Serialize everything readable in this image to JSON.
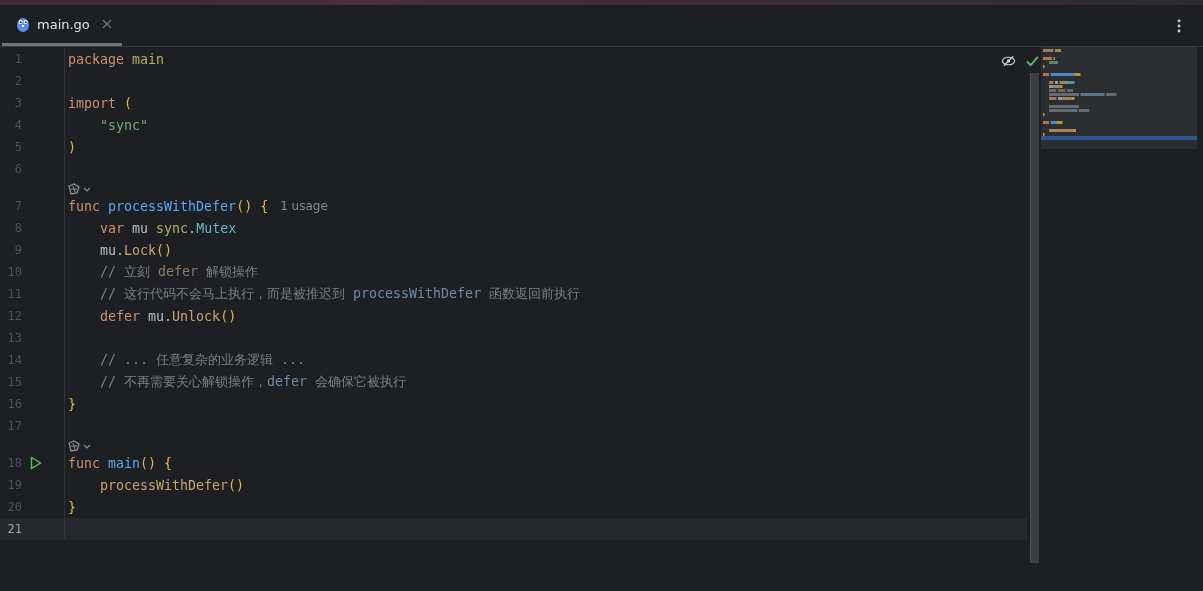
{
  "tabs": [
    {
      "label": "main.go",
      "selected": true
    }
  ],
  "lines": [
    {
      "number": "1",
      "current": false,
      "tokens": [
        {
          "t": "package ",
          "kind": "kw"
        },
        {
          "t": "main",
          "kind": "pkg"
        }
      ]
    },
    {
      "number": "2",
      "current": false
    },
    {
      "number": "3",
      "current": false,
      "tokens": [
        {
          "t": "import ",
          "kind": "kw"
        },
        {
          "t": "(",
          "kind": "paren"
        }
      ]
    },
    {
      "number": "4",
      "current": false,
      "tokens": [
        {
          "t": "    \"sync\"",
          "kind": "str"
        }
      ]
    },
    {
      "number": "5",
      "current": false,
      "tokens": [
        {
          "t": ")",
          "kind": "paren"
        }
      ]
    },
    {
      "number": "6",
      "current": false
    },
    {
      "number": "7",
      "current": false,
      "lens": true,
      "hint": "1 usage",
      "tokens": [
        {
          "t": "func ",
          "kind": "kw"
        },
        {
          "t": "processWithDefer",
          "kind": "fn"
        },
        {
          "t": "() {",
          "kind": "paren"
        }
      ]
    },
    {
      "number": "8",
      "current": false,
      "tokens": [
        {
          "t": "    var ",
          "kind": "kw"
        },
        {
          "t": "mu ",
          "kind": "plain"
        },
        {
          "t": "sync",
          "kind": "pkg"
        },
        {
          "t": ".",
          "kind": "plain"
        },
        {
          "t": "Mutex",
          "kind": "type"
        }
      ]
    },
    {
      "number": "9",
      "current": false,
      "tokens": [
        {
          "t": "    mu.",
          "kind": "plain"
        },
        {
          "t": "Lock",
          "kind": "method"
        },
        {
          "t": "()",
          "kind": "paren"
        }
      ]
    },
    {
      "number": "10",
      "current": false,
      "tokens": [
        {
          "t": "    // 立刻 ",
          "kind": "comment"
        },
        {
          "t": "defer",
          "kind": "ckw"
        },
        {
          "t": " 解锁操作",
          "kind": "comment"
        }
      ]
    },
    {
      "number": "11",
      "current": false,
      "tokens": [
        {
          "t": "    // 这行代码不会马上执行，而是被推迟到 ",
          "kind": "comment"
        },
        {
          "t": "processWithDefer",
          "kind": "cref"
        },
        {
          "t": " 函数返回前执行",
          "kind": "comment"
        }
      ]
    },
    {
      "number": "12",
      "current": false,
      "tokens": [
        {
          "t": "    defer ",
          "kind": "kw"
        },
        {
          "t": "mu.",
          "kind": "plain"
        },
        {
          "t": "Unlock",
          "kind": "method"
        },
        {
          "t": "()",
          "kind": "paren"
        }
      ]
    },
    {
      "number": "13",
      "current": false
    },
    {
      "number": "14",
      "current": false,
      "tokens": [
        {
          "t": "    // ... 任意复杂的业务逻辑 ...",
          "kind": "comment"
        }
      ]
    },
    {
      "number": "15",
      "current": false,
      "tokens": [
        {
          "t": "    // 不再需要关心解锁操作，",
          "kind": "comment"
        },
        {
          "t": "defer",
          "kind": "cref"
        },
        {
          "t": " 会确保它被执行",
          "kind": "comment"
        }
      ]
    },
    {
      "number": "16",
      "current": false,
      "tokens": [
        {
          "t": "}",
          "kind": "paren"
        }
      ]
    },
    {
      "number": "17",
      "current": false
    },
    {
      "number": "18",
      "current": false,
      "lens": true,
      "run": true,
      "tokens": [
        {
          "t": "func ",
          "kind": "kw"
        },
        {
          "t": "main",
          "kind": "fn"
        },
        {
          "t": "() {",
          "kind": "paren"
        }
      ]
    },
    {
      "number": "19",
      "current": false,
      "tokens": [
        {
          "t": "    processWithDefer",
          "kind": "method"
        },
        {
          "t": "()",
          "kind": "paren"
        }
      ]
    },
    {
      "number": "20",
      "current": false,
      "tokens": [
        {
          "t": "}",
          "kind": "paren"
        }
      ]
    },
    {
      "number": "21",
      "current": true
    }
  ]
}
